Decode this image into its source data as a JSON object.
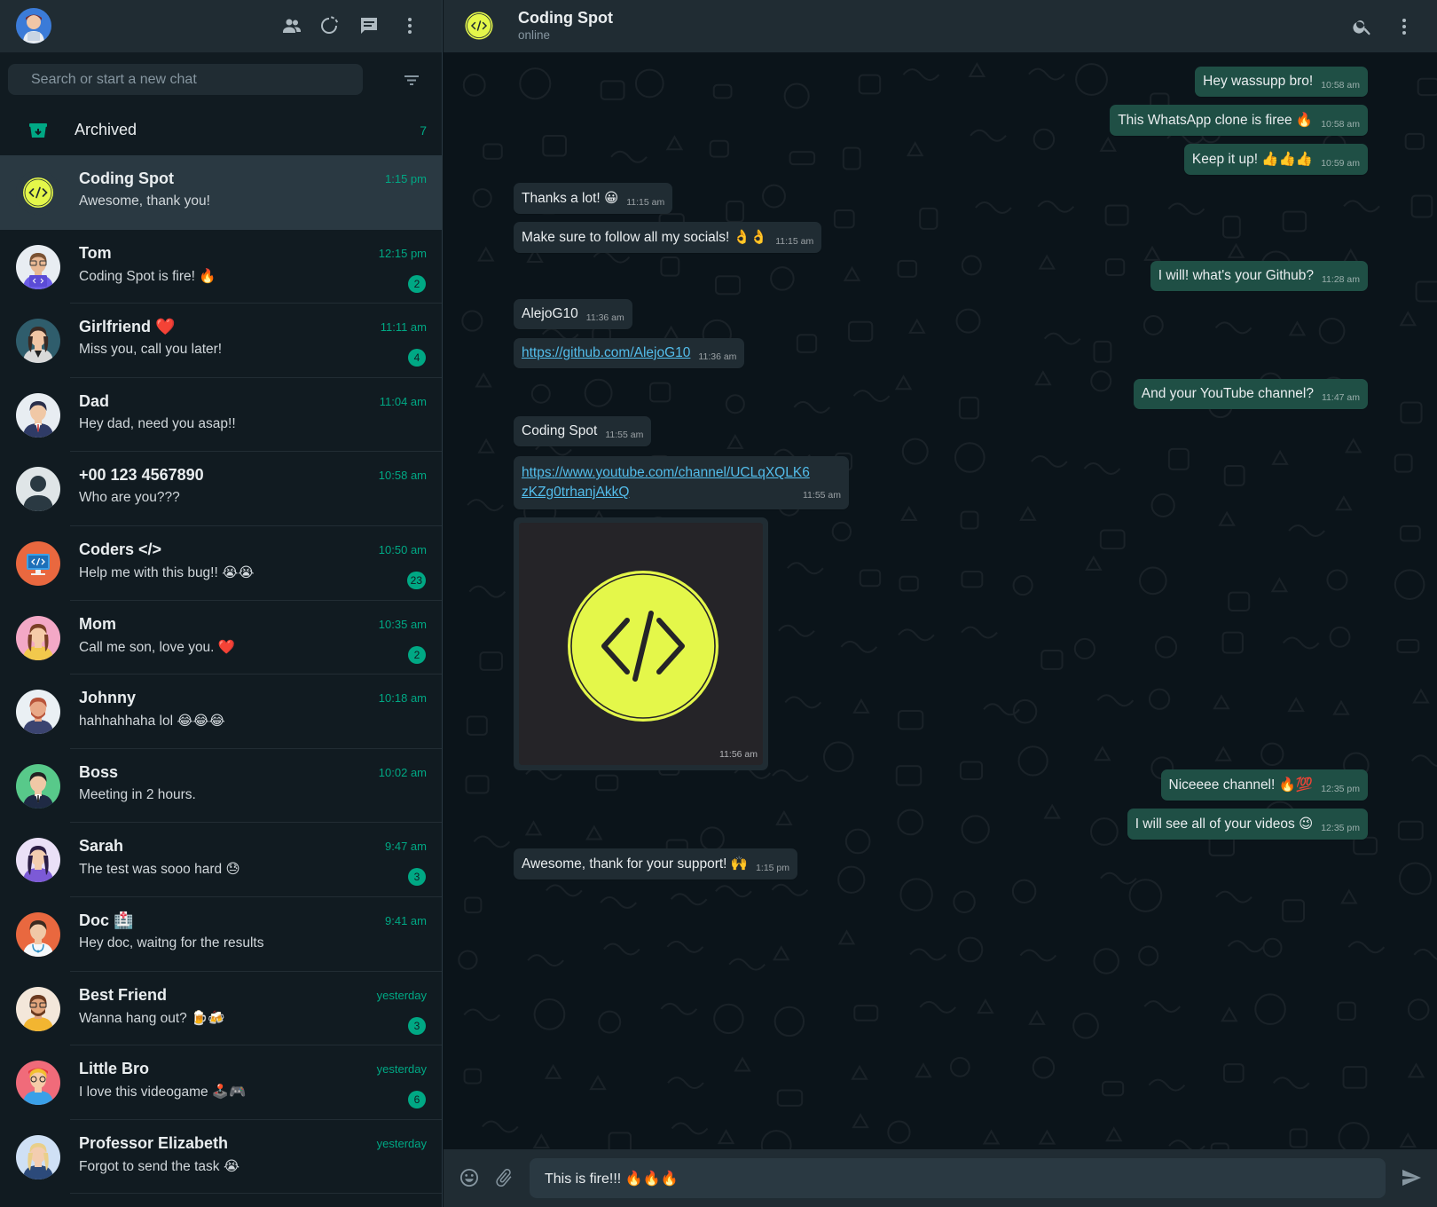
{
  "sidebar": {
    "search_placeholder": "Search or start a new chat",
    "archived": {
      "label": "Archived",
      "count": "7"
    },
    "chats": [
      {
        "name": "Coding Spot",
        "last": "Awesome, thank you!",
        "time": "1:15 pm",
        "unread": "",
        "avatar": "coding-spot",
        "active": true
      },
      {
        "name": "Tom",
        "last": "Coding Spot is fire! 🔥",
        "time": "12:15 pm",
        "unread": "2",
        "avatar": "tom"
      },
      {
        "name": "Girlfriend ❤️",
        "last": "Miss you, call you later!",
        "time": "11:11 am",
        "unread": "4",
        "avatar": "girlfriend"
      },
      {
        "name": "Dad",
        "last": "Hey dad, need you asap!!",
        "time": "11:04 am",
        "unread": "",
        "avatar": "dad"
      },
      {
        "name": "+00 123 4567890",
        "last": "Who are you???",
        "time": "10:58 am",
        "unread": "",
        "avatar": "unknown"
      },
      {
        "name": "Coders </>",
        "last": "Help me with this bug!! 😭😭",
        "time": "10:50 am",
        "unread": "23",
        "avatar": "coders"
      },
      {
        "name": "Mom",
        "last": "Call me son, love you. ❤️",
        "time": "10:35 am",
        "unread": "2",
        "avatar": "mom"
      },
      {
        "name": "Johnny",
        "last": "hahhahhaha lol 😂😂😂",
        "time": "10:18 am",
        "unread": "",
        "avatar": "johnny"
      },
      {
        "name": "Boss",
        "last": "Meeting in 2 hours.",
        "time": "10:02 am",
        "unread": "",
        "avatar": "boss"
      },
      {
        "name": "Sarah",
        "last": "The test was sooo hard 😓",
        "time": "9:47 am",
        "unread": "3",
        "avatar": "sarah"
      },
      {
        "name": "Doc 🏥",
        "last": "Hey doc, waitng for the results",
        "time": "9:41 am",
        "unread": "",
        "avatar": "doc"
      },
      {
        "name": "Best Friend",
        "last": "Wanna hang out? 🍺🍻",
        "time": "yesterday",
        "unread": "3",
        "avatar": "best-friend"
      },
      {
        "name": "Little Bro",
        "last": "I love this videogame 🕹️🎮",
        "time": "yesterday",
        "unread": "6",
        "avatar": "little-bro"
      },
      {
        "name": "Professor Elizabeth",
        "last": "Forgot to send the task 😭",
        "time": "yesterday",
        "unread": "",
        "avatar": "professor"
      }
    ]
  },
  "conversation": {
    "contact_name": "Coding Spot",
    "contact_status": "online",
    "messages": [
      {
        "dir": "out",
        "text": "Hey wassupp bro!",
        "time": "10:58 am"
      },
      {
        "dir": "out",
        "text": "This WhatsApp clone is firee 🔥",
        "time": "10:58 am"
      },
      {
        "dir": "out",
        "text": "Keep it up! 👍👍👍",
        "time": "10:59 am"
      },
      {
        "dir": "in",
        "text": "Thanks a lot! 😀",
        "time": "11:15 am"
      },
      {
        "dir": "in",
        "text": "Make sure to follow all my socials! 👌👌",
        "time": "11:15 am"
      },
      {
        "dir": "out",
        "text": "I will! what's your Github?",
        "time": "11:28 am"
      },
      {
        "dir": "in",
        "text": "AlejoG10",
        "time": "11:36 am"
      },
      {
        "dir": "in",
        "link": "https://github.com/AlejoG10",
        "time": "11:36 am"
      },
      {
        "dir": "out",
        "text": "And your YouTube channel?",
        "time": "11:47 am"
      },
      {
        "dir": "in",
        "text": "Coding Spot",
        "time": "11:55 am"
      },
      {
        "dir": "in",
        "link_line1": "https://www.youtube.com/channel/UCLqXQLK6",
        "link_line2": "zKZg0trhanjAkkQ",
        "time": "11:55 am"
      },
      {
        "dir": "in",
        "image": "coding-spot-logo",
        "time": "11:56 am"
      },
      {
        "dir": "out",
        "text": "Niceeee channel! 🔥💯",
        "time": "12:35 pm"
      },
      {
        "dir": "out",
        "text": "I will see all of your videos 😉",
        "time": "12:35 pm"
      },
      {
        "dir": "in",
        "text": "Awesome, thank for your support! 🙌",
        "time": "1:15 pm"
      }
    ]
  },
  "composer": {
    "value": "This is fire!!! 🔥🔥🔥"
  },
  "colors": {
    "accent": "#00a884",
    "outgoing_bubble": "#1f4f45",
    "incoming_bubble": "#202c33",
    "brand_yellow": "#e4f74a"
  }
}
